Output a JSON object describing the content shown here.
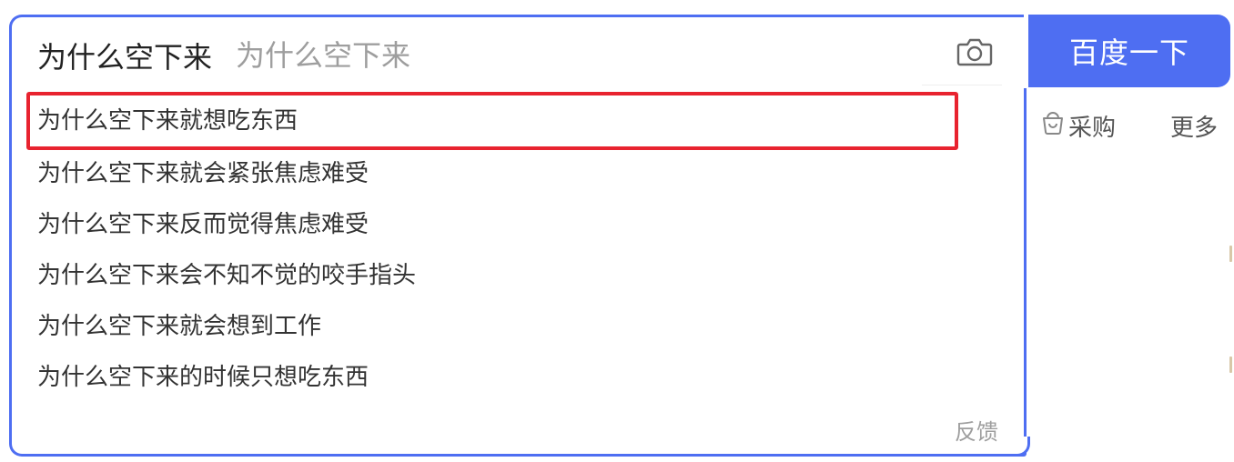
{
  "search": {
    "query": "为什么空下来",
    "ghost_text": "为什么空下来",
    "button_label": "百度一下",
    "suggestions": [
      "为什么空下来就想吃东西",
      "为什么空下来就会紧张焦虑难受",
      "为什么空下来反而觉得焦虑难受",
      "为什么空下来会不知不觉的咬手指头",
      "为什么空下来就会想到工作",
      "为什么空下来的时候只想吃东西"
    ],
    "feedback_label": "反馈"
  },
  "links": {
    "shop_label": "采购",
    "more_label": "更多"
  },
  "colors": {
    "accent": "#4e6ef2",
    "highlight_border": "#e8232f"
  },
  "icons": {
    "camera": "camera-icon",
    "shop": "shopping-basket-icon"
  }
}
